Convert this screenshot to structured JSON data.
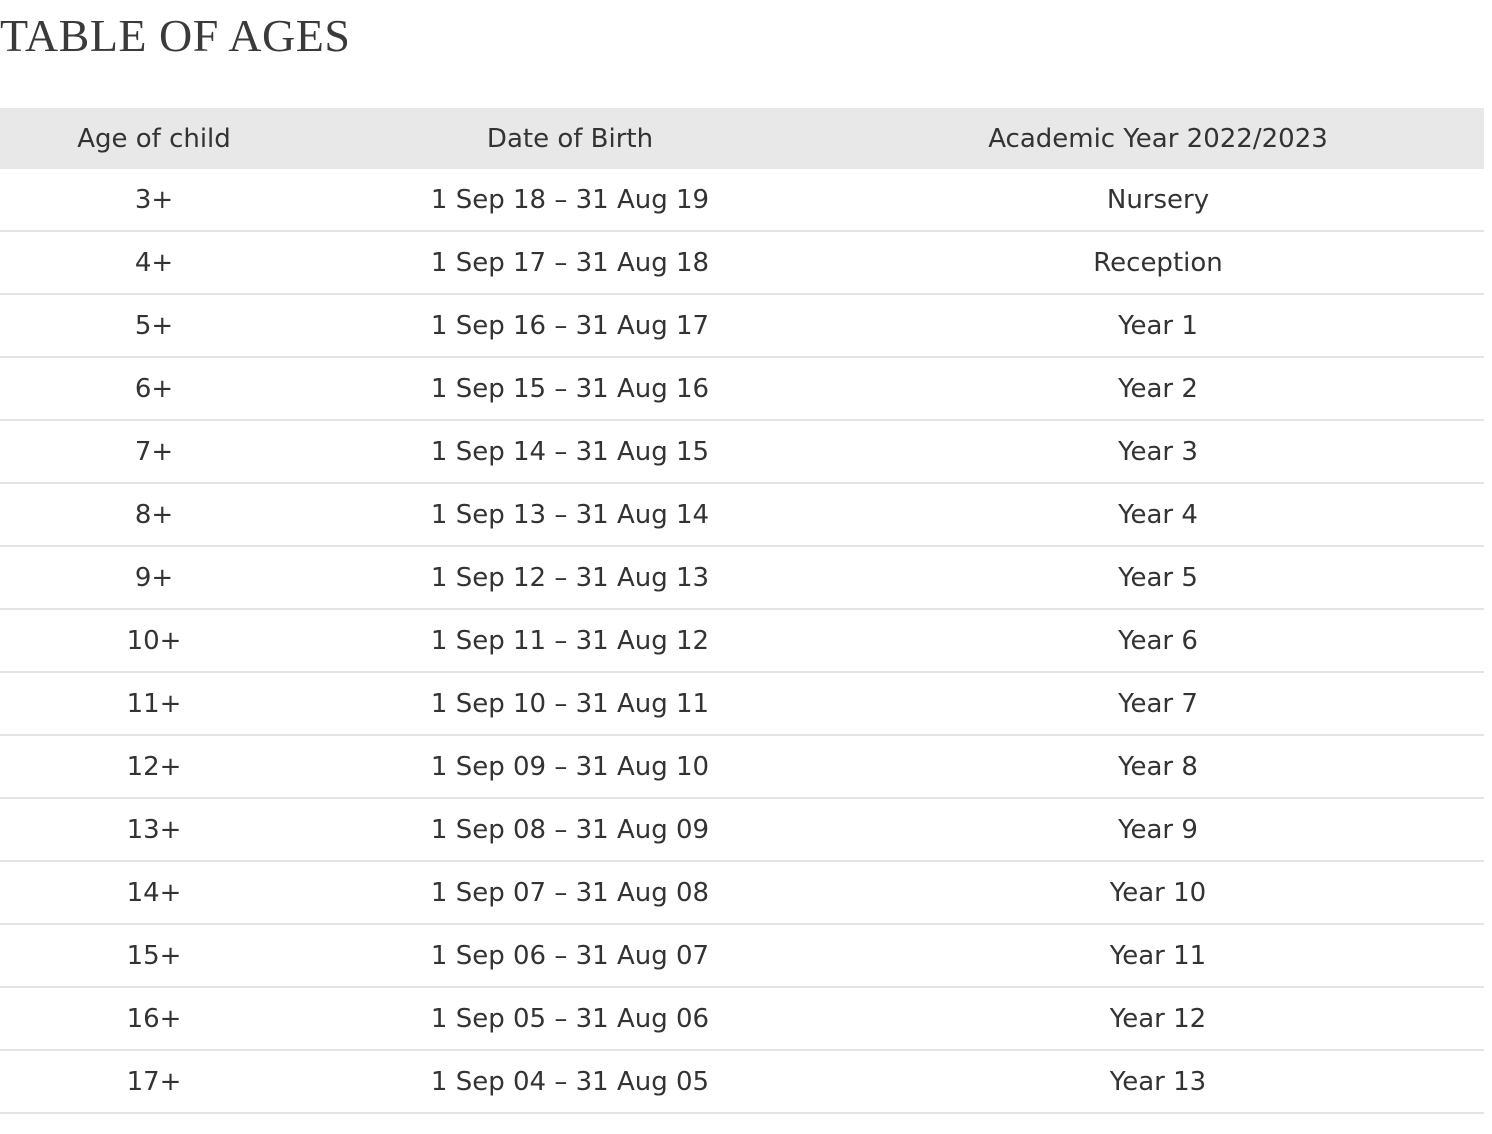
{
  "title": "TABLE OF AGES",
  "table": {
    "headers": [
      "Age of child",
      "Date of Birth",
      "Academic Year 2022/2023"
    ],
    "rows": [
      [
        "3+",
        "1 Sep 18 – 31 Aug 19",
        "Nursery"
      ],
      [
        "4+",
        "1 Sep 17 – 31 Aug 18",
        "Reception"
      ],
      [
        "5+",
        "1 Sep 16 – 31 Aug 17",
        "Year 1"
      ],
      [
        "6+",
        "1 Sep 15 – 31 Aug 16",
        "Year 2"
      ],
      [
        "7+",
        "1 Sep 14 – 31 Aug 15",
        "Year 3"
      ],
      [
        "8+",
        "1 Sep 13 – 31 Aug 14",
        "Year 4"
      ],
      [
        "9+",
        "1 Sep 12 – 31 Aug 13",
        "Year 5"
      ],
      [
        "10+",
        "1 Sep 11 – 31 Aug 12",
        "Year 6"
      ],
      [
        "11+",
        "1 Sep 10 – 31 Aug 11",
        "Year 7"
      ],
      [
        "12+",
        "1 Sep 09 – 31 Aug 10",
        "Year 8"
      ],
      [
        "13+",
        "1 Sep 08 – 31 Aug 09",
        "Year 9"
      ],
      [
        "14+",
        "1 Sep 07 – 31 Aug 08",
        "Year 10"
      ],
      [
        "15+",
        "1 Sep 06 – 31 Aug 07",
        "Year 11"
      ],
      [
        "16+",
        "1 Sep 05 – 31 Aug 06",
        "Year 12"
      ],
      [
        "17+",
        "1 Sep 04 – 31 Aug 05",
        "Year 13"
      ]
    ]
  },
  "colors": {
    "header_background": "#e8e8e8",
    "row_divider": "#e4e4e4",
    "text": "#333333"
  }
}
